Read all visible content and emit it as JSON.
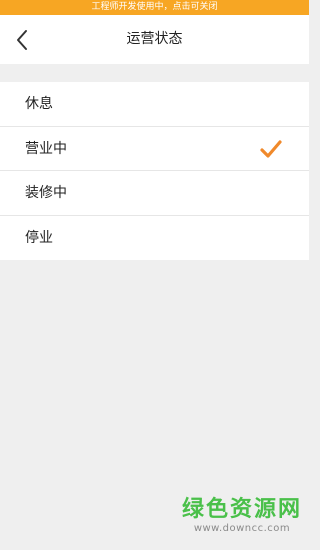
{
  "banner": {
    "text": "工程师开发使用中，点击可关闭"
  },
  "header": {
    "title": "运营状态",
    "back_icon": "chevron-left-icon"
  },
  "status_options": [
    {
      "label": "休息",
      "selected": false
    },
    {
      "label": "营业中",
      "selected": true
    },
    {
      "label": "装修中",
      "selected": false
    },
    {
      "label": "停业",
      "selected": false
    }
  ],
  "colors": {
    "banner": "#f7a623",
    "check": "#f0892b",
    "background": "#efefef",
    "watermark": "#2eb82e"
  },
  "watermark": {
    "title": "绿色资源网",
    "url": "www.downcc.com"
  }
}
